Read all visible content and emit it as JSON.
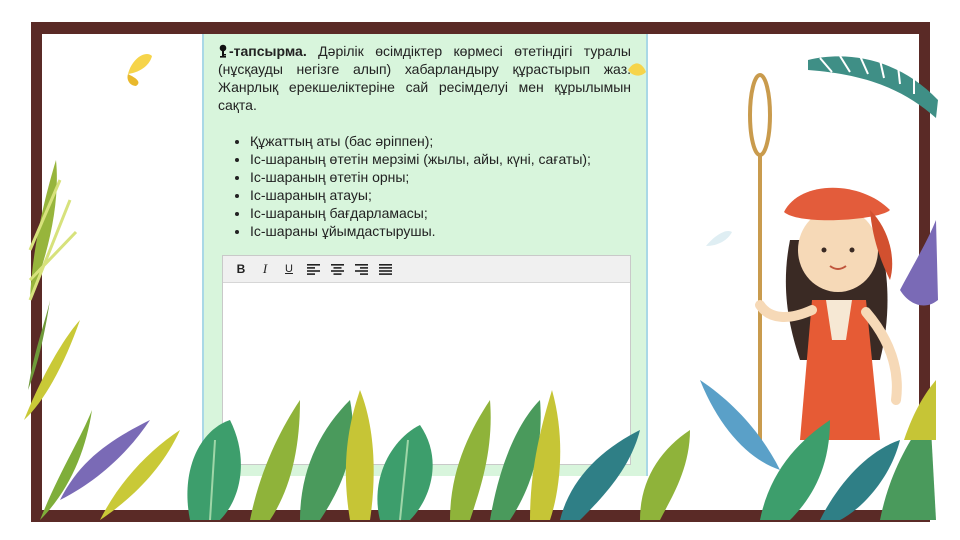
{
  "task": {
    "title": "-тапсырма.",
    "body": "Дәрілік өсімдіктер көрмесі өтетіндігі туралы (нұсқауды негізге алып) хабарландыру құрастырып жаз. Жанрлық ерекшеліктеріне сай ресімделуі мен құрылымын сақта."
  },
  "instructions": [
    "Құжаттың аты (бас әріппен);",
    "Іс-шараның өтетін мерзімі (жылы, айы, күні, сағаты);",
    "Іс-шараның өтетін орны;",
    "Іс-шараның атауы;",
    "Іс-шараның бағдарламасы;",
    "Іс-шараны ұйымдастырушы."
  ],
  "editor": {
    "toolbar": {
      "bold": "B",
      "italic": "I",
      "underline": "U"
    },
    "value": ""
  },
  "colors": {
    "frame": "#5a2a26",
    "panel": "#d8f5dc",
    "panel_border": "#a9d8e6",
    "toolbar": "#f0f0f0"
  },
  "icons": [
    "key-icon",
    "bold-icon",
    "italic-icon",
    "underline-icon",
    "align-left-icon",
    "align-center-icon",
    "align-right-icon",
    "align-justify-icon"
  ]
}
